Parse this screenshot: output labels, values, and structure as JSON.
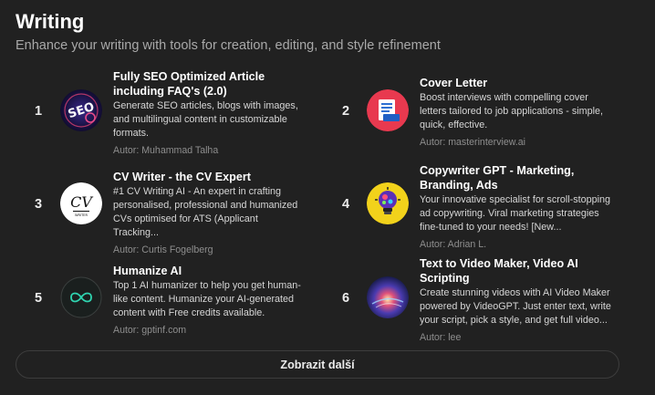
{
  "section": {
    "title": "Writing",
    "subtitle": "Enhance your writing with tools for creation, editing, and style refinement"
  },
  "items": [
    {
      "rank": "1",
      "name": "Fully SEO Optimized Article including FAQ's (2.0)",
      "description": "Generate SEO articles, blogs with images, and multilingual content in customizable formats.",
      "author": "Autor: Muhammad Talha",
      "icon": "seo-logo-icon"
    },
    {
      "rank": "2",
      "name": "Cover Letter",
      "description": "Boost interviews with compelling cover letters tailored to job applications - simple, quick, effective.",
      "author": "Autor: masterinterview.ai",
      "icon": "document-icon"
    },
    {
      "rank": "3",
      "name": "CV Writer - the CV Expert",
      "description": "#1 CV Writing AI - An expert in crafting personalised, professional and humanized CVs optimised for ATS (Applicant Tracking...",
      "author": "Autor: Curtis Fogelberg",
      "icon": "cv-writer-logo-icon"
    },
    {
      "rank": "4",
      "name": "Copywriter GPT - Marketing, Branding, Ads",
      "description": "Your innovative specialist for scroll-stopping ad copywriting. Viral marketing strategies fine-tuned to your needs! [New...",
      "author": "Autor: Adrian L.",
      "icon": "lightbulb-icon"
    },
    {
      "rank": "5",
      "name": "Humanize AI",
      "description": "Top 1 AI humanizer to help you get human-like content. Humanize your AI-generated content with Free credits available.",
      "author": "Autor: gptinf.com",
      "icon": "infinity-icon"
    },
    {
      "rank": "6",
      "name": "Text to Video Maker, Video AI Scripting",
      "description": "Create stunning videos with AI Video Maker powered by VideoGPT. Just enter text, write your script, pick a style, and get full video...",
      "author": "Autor: lee",
      "icon": "galaxy-icon"
    }
  ],
  "show_more_label": "Zobrazit další",
  "colors": {
    "background": "#212121",
    "text_primary": "#ffffff",
    "text_secondary": "#a9a9a9",
    "author": "#8e8e8e",
    "border": "#3d3d3d"
  }
}
